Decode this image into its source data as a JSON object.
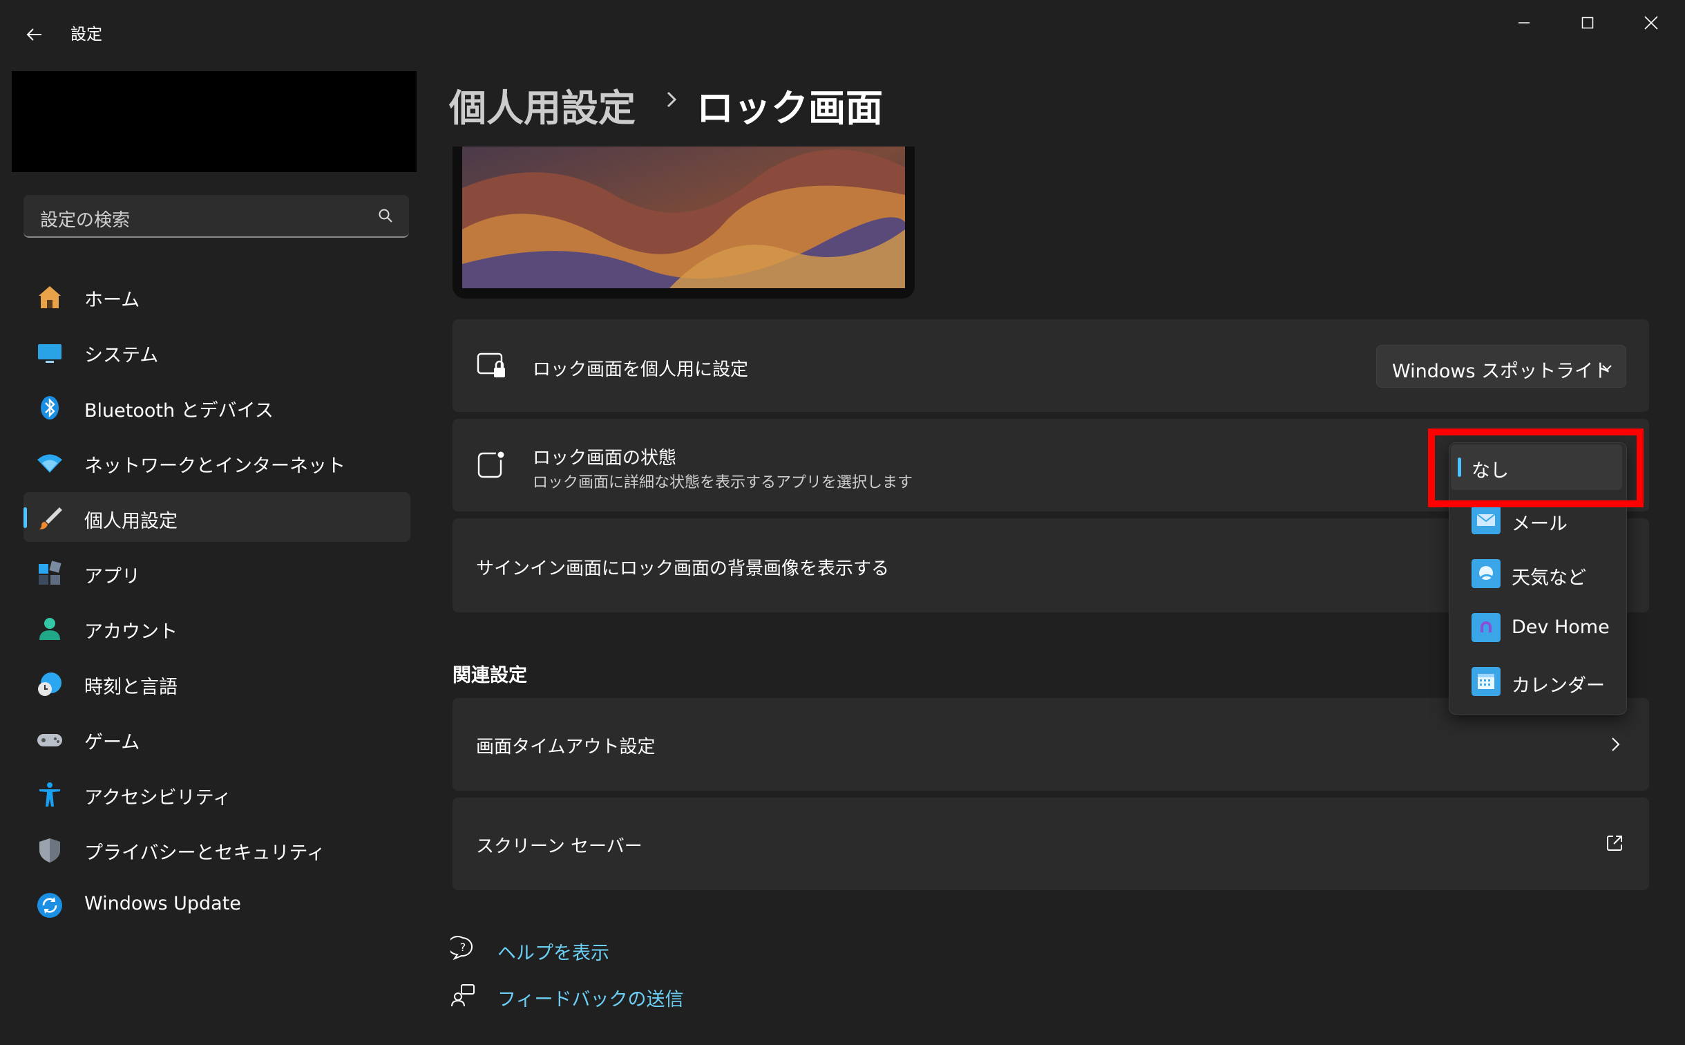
{
  "window": {
    "title": "設定",
    "controls": [
      "minimize",
      "maximize",
      "close"
    ]
  },
  "search": {
    "placeholder": "設定の検索"
  },
  "sidebar": {
    "items": [
      {
        "label": "ホーム",
        "icon": "home-icon"
      },
      {
        "label": "システム",
        "icon": "system-icon"
      },
      {
        "label": "Bluetooth とデバイス",
        "icon": "bluetooth-icon"
      },
      {
        "label": "ネットワークとインターネット",
        "icon": "network-icon"
      },
      {
        "label": "個人用設定",
        "icon": "brush-icon",
        "selected": true
      },
      {
        "label": "アプリ",
        "icon": "apps-icon"
      },
      {
        "label": "アカウント",
        "icon": "account-icon"
      },
      {
        "label": "時刻と言語",
        "icon": "time-language-icon"
      },
      {
        "label": "ゲーム",
        "icon": "gaming-icon"
      },
      {
        "label": "アクセシビリティ",
        "icon": "accessibility-icon"
      },
      {
        "label": "プライバシーとセキュリティ",
        "icon": "shield-icon"
      },
      {
        "label": "Windows Update",
        "icon": "update-icon"
      }
    ]
  },
  "breadcrumb": {
    "parent": "個人用設定",
    "current": "ロック画面"
  },
  "cards": {
    "personalize": {
      "title": "ロック画面を個人用に設定",
      "value": "Windows スポットライト"
    },
    "status": {
      "title": "ロック画面の状態",
      "subtitle": "ロック画面に詳細な状態を表示するアプリを選択します"
    },
    "signin": {
      "title": "サインイン画面にロック画面の背景画像を表示する"
    }
  },
  "status_menu": {
    "options": [
      {
        "label": "なし",
        "selected": true
      },
      {
        "label": "メール",
        "icon": "mail-icon"
      },
      {
        "label": "天気など",
        "icon": "weather-icon"
      },
      {
        "label": "Dev Home",
        "icon": "dev-home-icon"
      },
      {
        "label": "カレンダー",
        "icon": "calendar-icon"
      }
    ]
  },
  "related": {
    "title": "関連設定",
    "items": [
      {
        "label": "画面タイムアウト設定",
        "icon": "chevron-right-icon"
      },
      {
        "label": "スクリーン セーバー",
        "icon": "external-link-icon"
      }
    ]
  },
  "footer": {
    "help": "ヘルプを表示",
    "feedback": "フィードバックの送信"
  },
  "colors": {
    "background": "#202020",
    "card": "#2b2b2b",
    "accent": "#4cc2ff",
    "link": "#6ccff6",
    "highlight": "#ff0000"
  }
}
